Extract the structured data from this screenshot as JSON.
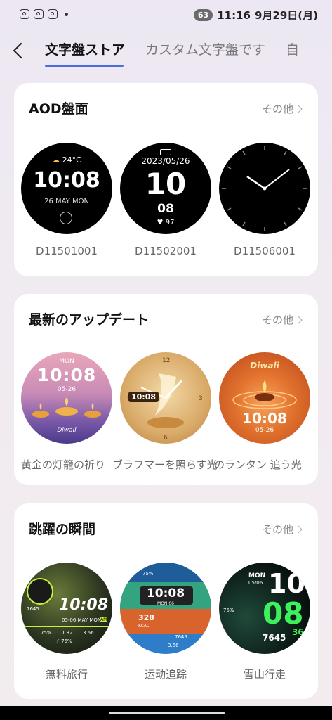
{
  "status": {
    "battery": "63",
    "time": "11:16",
    "date": "9月29日(月)"
  },
  "tabs": {
    "active": "文字盤ストア",
    "second": "カスタム文字盤です",
    "third": "自"
  },
  "sections": {
    "aod": {
      "title": "AOD盤面",
      "more": "その他",
      "faces": [
        {
          "caption": "D11501001",
          "temp": "24°C",
          "time": "10:08",
          "date": "26 MAY MON"
        },
        {
          "caption": "D11502001",
          "date": "2023/05/26",
          "hour": "10",
          "minute": "08",
          "heart": "97"
        },
        {
          "caption": "D11506001"
        }
      ]
    },
    "latest": {
      "title": "最新のアップデート",
      "more": "その他",
      "faces": [
        {
          "caption": "黄金の灯籠の祈り",
          "top": "MON",
          "time": "10:08",
          "date": "05-26",
          "brand": "Diwali"
        },
        {
          "caption": "ブラフマーを照らす光",
          "time": "10:08"
        },
        {
          "caption": "のランタン 追う光",
          "brand": "Diwali",
          "time": "10:08",
          "date": "05-26"
        }
      ]
    },
    "leap": {
      "title": "跳躍の瞬間",
      "more": "その他",
      "faces": [
        {
          "caption": "無料旅行",
          "time": "10:08",
          "date": "05-06 MAY MON",
          "steps": "7645",
          "m1": "75%",
          "m2": "1.32",
          "m3": "3.66",
          "ampm": "AM"
        },
        {
          "caption": "运动追踪",
          "pct": "75%",
          "time": "10:08",
          "date": "MON 06",
          "kcal": "328",
          "kcal_label": "KCAL",
          "steps": "7645",
          "dist": "3.66"
        },
        {
          "caption": "雪山行走",
          "day": "MON",
          "date": "05/06",
          "hour": "10",
          "minute": "08",
          "sec": "36",
          "pct": "75%",
          "steps": "7645"
        }
      ]
    }
  }
}
